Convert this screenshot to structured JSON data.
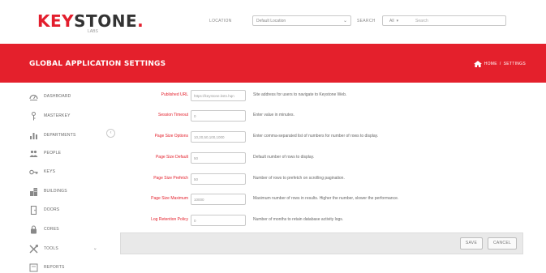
{
  "brand": {
    "name_part1": "KEY",
    "name_part2": "STONE",
    "dot": ".",
    "tagline": "LABS"
  },
  "header": {
    "location_label": "LOCATION",
    "location_value": "Default Location",
    "search_label": "SEARCH",
    "search_scope": "All",
    "search_placeholder": "Search"
  },
  "banner": {
    "title": "GLOBAL APPLICATION SETTINGS",
    "breadcrumb": [
      "HOME",
      "/",
      "SETTINGS"
    ]
  },
  "sidebar": {
    "items": [
      {
        "label": "DASHBOARD",
        "icon": "dashboard-icon"
      },
      {
        "label": "MASTERKEY",
        "icon": "masterkey-icon"
      },
      {
        "label": "DEPARTMENTS",
        "icon": "departments-icon"
      },
      {
        "label": "PEOPLE",
        "icon": "people-icon"
      },
      {
        "label": "KEYS",
        "icon": "keys-icon"
      },
      {
        "label": "BUILDINGS",
        "icon": "buildings-icon"
      },
      {
        "label": "DOORS",
        "icon": "doors-icon"
      },
      {
        "label": "CORES",
        "icon": "cores-icon"
      },
      {
        "label": "TOOLS",
        "icon": "tools-icon"
      },
      {
        "label": "REPORTS",
        "icon": "reports-icon"
      }
    ]
  },
  "settings": {
    "rows": [
      {
        "label": "Published URL",
        "value": "https://keystone.kstn.hqn",
        "description": "Site address for users to navigate to Keystone Web."
      },
      {
        "label": "Session Timeout",
        "value": "0",
        "description": "Enter value in minutes."
      },
      {
        "label": "Page Size Options",
        "value": "10,20,50,100,1000",
        "description": "Enter comma-separated list of numbers for number of rows to display."
      },
      {
        "label": "Page Size Default",
        "value": "50",
        "description": "Default number of rows to display."
      },
      {
        "label": "Page Size Prefetch",
        "value": "50",
        "description": "Number of rows to prefetch on scrolling pagination."
      },
      {
        "label": "Page Size Maximum",
        "value": "10000",
        "description": "Maximum number of rows in results. Higher the number, slower the performance."
      },
      {
        "label": "Log Retention Policy",
        "value": "0",
        "description": "Number of months to retain database activity logs."
      }
    ],
    "save_label": "SAVE",
    "cancel_label": "CANCEL"
  },
  "colors": {
    "accent": "#e4202c",
    "text": "#666666",
    "footer_bg": "#e9e9e9"
  }
}
